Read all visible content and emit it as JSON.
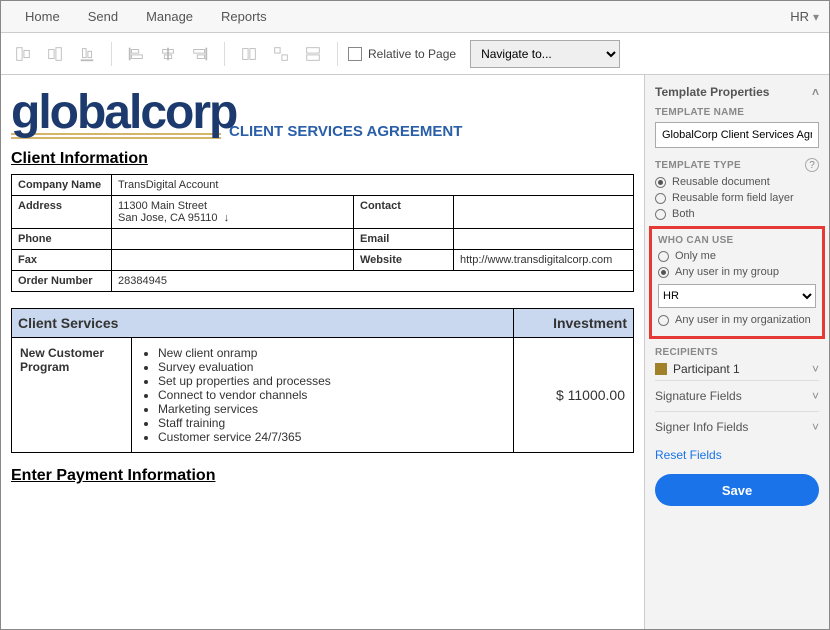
{
  "menubar": {
    "items": [
      "Home",
      "Send",
      "Manage",
      "Reports"
    ],
    "user": "HR"
  },
  "toolbar": {
    "relative_label": "Relative to Page",
    "navigate_placeholder": "Navigate to..."
  },
  "doc": {
    "logo_text": "globalcorp",
    "title": "CLIENT SERVICES AGREEMENT",
    "section_client_info": "Client Information",
    "info": {
      "company_label": "Company Name",
      "company_value": "TransDigital Account",
      "address_label": "Address",
      "address_line1": "11300 Main Street",
      "address_line2": "San Jose, CA  95110",
      "contact_label": "Contact",
      "phone_label": "Phone",
      "email_label": "Email",
      "fax_label": "Fax",
      "website_label": "Website",
      "website_value": "http://www.transdigitalcorp.com",
      "order_label": "Order Number",
      "order_value": "28384945"
    },
    "services_header_left": "Client Services",
    "services_header_right": "Investment",
    "services_row_label": "New Customer Program",
    "services_items": [
      "New client onramp",
      "Survey evaluation",
      "Set up properties and processes",
      "Connect to vendor channels",
      "Marketing services",
      "Staff training",
      "Customer service 24/7/365"
    ],
    "services_amount": "$ 11000.00",
    "section_payment": "Enter Payment Information"
  },
  "panel": {
    "header": "Template Properties",
    "name_label": "TEMPLATE NAME",
    "name_value": "GlobalCorp Client Services Agreement",
    "type_label": "TEMPLATE TYPE",
    "type_options": [
      "Reusable document",
      "Reusable form field layer",
      "Both"
    ],
    "who_label": "WHO CAN USE",
    "who_options": [
      "Only me",
      "Any user in my group",
      "Any user in my organization"
    ],
    "who_group_value": "HR",
    "recipients_label": "RECIPIENTS",
    "participant": "Participant 1",
    "sig_fields": "Signature Fields",
    "signer_fields": "Signer Info Fields",
    "reset": "Reset Fields",
    "save": "Save"
  }
}
